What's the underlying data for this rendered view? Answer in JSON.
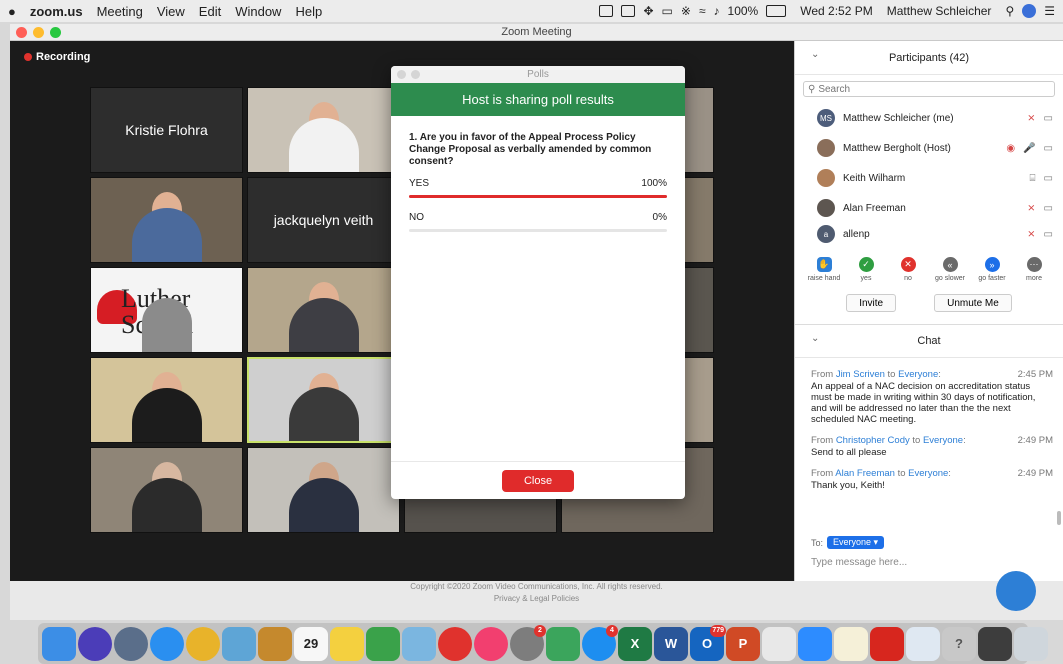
{
  "menubar": {
    "apple": "",
    "app": "zoom.us",
    "menus": [
      "Meeting",
      "View",
      "Edit",
      "Window",
      "Help"
    ],
    "battery": "100%",
    "clock": "Wed 2:52 PM",
    "user": "Matthew Schleicher"
  },
  "window": {
    "title": "Zoom Meeting",
    "recording_label": "Recording"
  },
  "gallery": {
    "names": {
      "tile1": "Kristie Flohra",
      "tile6": "jackquelyn veith"
    },
    "logo_text": "Luther School"
  },
  "poll": {
    "window_title": "Polls",
    "header": "Host is sharing poll results",
    "question": "1. Are you in favor of the Appeal Process Policy Change Proposal as verbally amended by common consent?",
    "options": [
      {
        "label": "YES",
        "percent_text": "100%",
        "percent": 100
      },
      {
        "label": "NO",
        "percent_text": "0%",
        "percent": 0
      }
    ],
    "close_label": "Close",
    "bar_color": "#e02b2b",
    "header_color": "#2d8c4e"
  },
  "participants": {
    "title": "Participants (42)",
    "search_placeholder": "Search",
    "list": [
      {
        "name": "Matthew Schleicher (me)",
        "initials": "MS"
      },
      {
        "name": "Matthew Bergholt (Host)",
        "initials": ""
      },
      {
        "name": "Keith Wilharm",
        "initials": ""
      },
      {
        "name": "Alan Freeman",
        "initials": ""
      },
      {
        "name": "allenp",
        "initials": "a"
      }
    ],
    "reactions": [
      {
        "label": "raise hand"
      },
      {
        "label": "yes"
      },
      {
        "label": "no"
      },
      {
        "label": "go slower"
      },
      {
        "label": "go faster"
      },
      {
        "label": "more"
      }
    ],
    "invite_label": "Invite",
    "unmute_label": "Unmute Me"
  },
  "chat": {
    "title": "Chat",
    "messages": [
      {
        "from": "Jim Scriven",
        "to": "Everyone",
        "time": "2:45 PM",
        "text": "An appeal of a NAC decision on accreditation status must be made in writing within 30 days of notification, and will be addressed no later than the the next scheduled NAC meeting."
      },
      {
        "from": "Christopher Cody",
        "to": "Everyone",
        "time": "2:49 PM",
        "text": "Send to all please"
      },
      {
        "from": "Alan Freeman",
        "to": "Everyone",
        "time": "2:49 PM",
        "text": "Thank you, Keith!"
      }
    ],
    "to_label": "To:",
    "recipient": "Everyone",
    "input_placeholder": "Type message here..."
  },
  "footer": {
    "copyright": "Copyright ©2020 Zoom Video Communications, Inc. All rights reserved.",
    "privacy": "Privacy & Legal Policies"
  },
  "dock": {
    "calendar_day": "29",
    "badges": {
      "appstore": "4",
      "outlook": "779",
      "settings": "2"
    }
  }
}
